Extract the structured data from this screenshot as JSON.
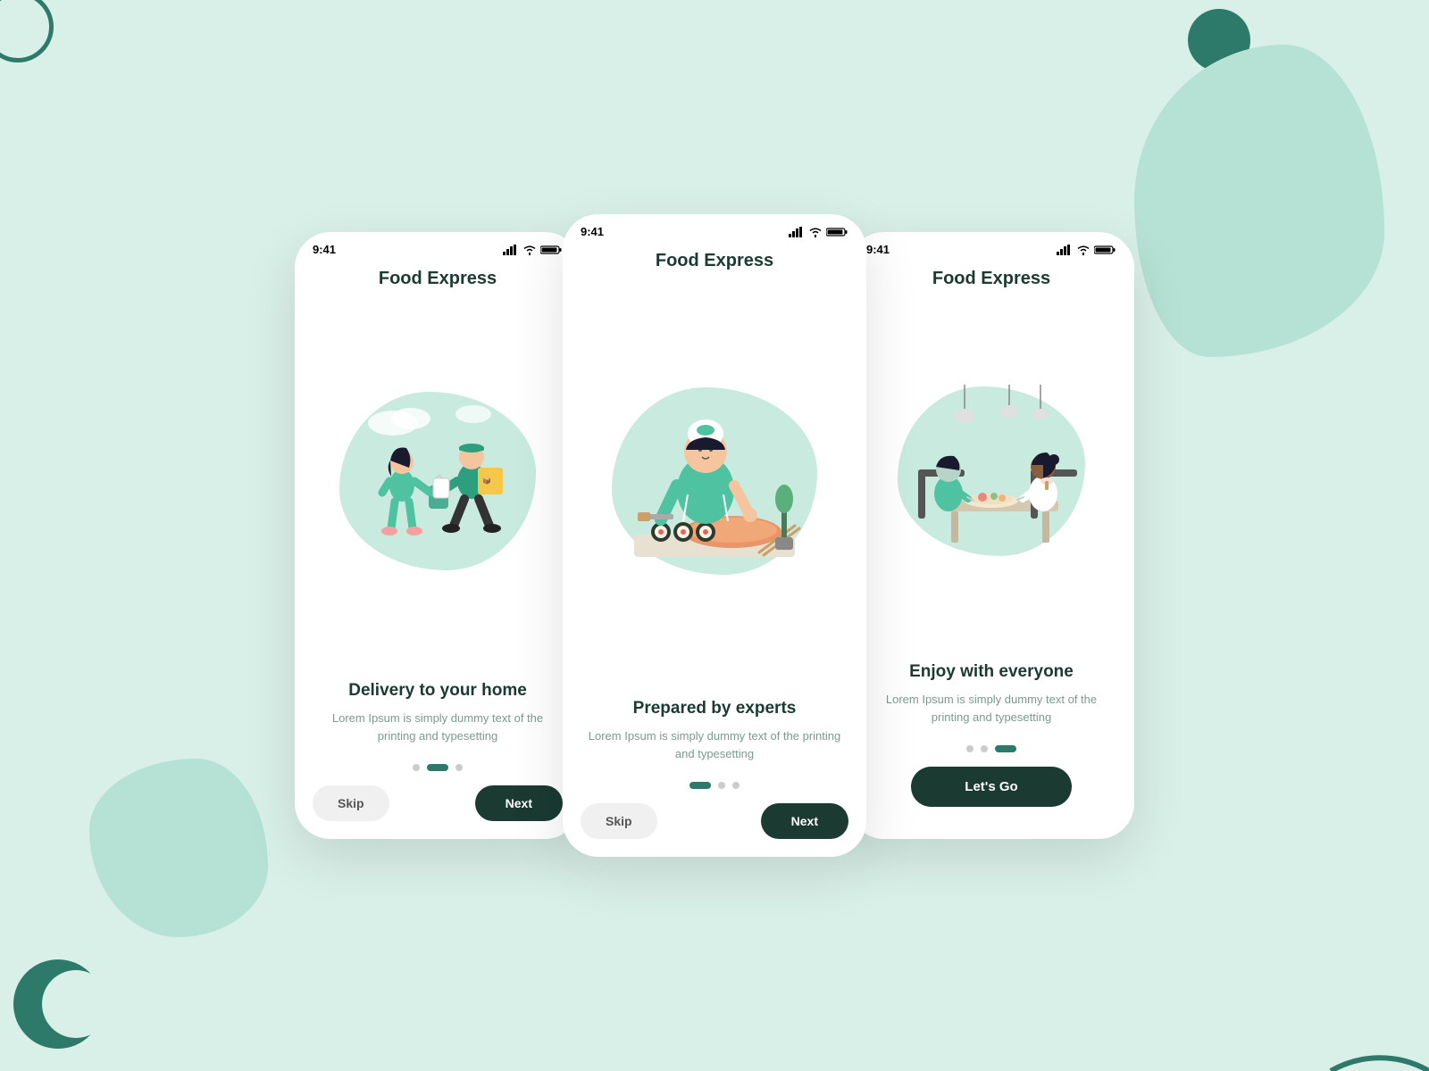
{
  "background": {
    "color": "#d9f0e8"
  },
  "phones": [
    {
      "id": "phone-left",
      "status_bar": {
        "time": "9:41",
        "icons": "▪▪▪ ⌇ ▮"
      },
      "title": "Food Express",
      "illustration": "delivery",
      "content_title": "Delivery to  your home",
      "content_desc": "Lorem Ipsum is simply dummy text of the printing and typesetting",
      "dots": [
        "inactive",
        "active",
        "inactive"
      ],
      "buttons": {
        "skip": "Skip",
        "next": "Next"
      }
    },
    {
      "id": "phone-center",
      "status_bar": {
        "time": "9:41",
        "icons": "▪▪▪ ⌇ ▮"
      },
      "title": "Food Express",
      "illustration": "chef",
      "content_title": "Prepared by experts",
      "content_desc": "Lorem Ipsum is simply dummy text of the printing and typesetting",
      "dots": [
        "active",
        "inactive",
        "inactive"
      ],
      "buttons": {
        "skip": "Skip",
        "next": "Next"
      }
    },
    {
      "id": "phone-right",
      "status_bar": {
        "time": "9:41",
        "icons": "▪▪▪ ⌇ ▮"
      },
      "title": "Food Express",
      "illustration": "dining",
      "content_title": "Enjoy with everyone",
      "content_desc": "Lorem Ipsum is simply dummy text of the printing and typesetting",
      "dots": [
        "inactive",
        "inactive",
        "active"
      ],
      "buttons": {
        "lets_go": "Let's Go"
      }
    }
  ]
}
